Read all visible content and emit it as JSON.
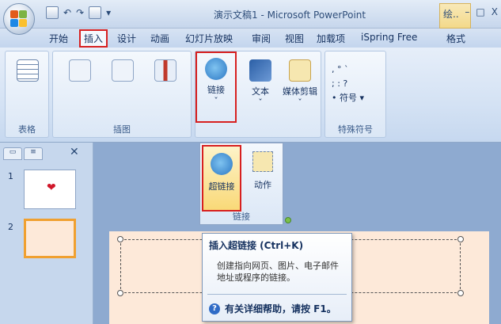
{
  "window": {
    "title": "演示文稿1 - Microsoft PowerPoint",
    "context_tab": "绘..",
    "controls": [
      "–",
      "□",
      "X"
    ]
  },
  "qat": {
    "undo": "↶",
    "redo": "↷",
    "dropdown": "▾"
  },
  "tabs": [
    "开始",
    "插入",
    "设计",
    "动画",
    "幻灯片放映",
    "审阅",
    "视图",
    "加载项",
    "iSpring Free",
    "格式"
  ],
  "ribbon": {
    "groups": {
      "table": "表格",
      "illustrations": "插图",
      "special_symbols": "特殊符号"
    },
    "buttons": {
      "link": "链接",
      "text": "文本",
      "media": "媒体剪辑",
      "symbol": "符号"
    },
    "symbols": [
      ", ° ˋ",
      "; : ?"
    ]
  },
  "dropdown": {
    "hyperlink": "超链接",
    "action": "动作",
    "group_label": "链接"
  },
  "tooltip": {
    "title": "插入超链接 (Ctrl+K)",
    "body": "创建指向网页、图片、电子邮件地址或程序的链接。",
    "help": "有关详细帮助，请按 F1。"
  },
  "slides": [
    {
      "number": "1"
    },
    {
      "number": "2"
    }
  ],
  "colors": {
    "highlight": "#d72020",
    "ribbon_bg": "#dbe7f6",
    "slide_bg": "#fde9d9"
  }
}
